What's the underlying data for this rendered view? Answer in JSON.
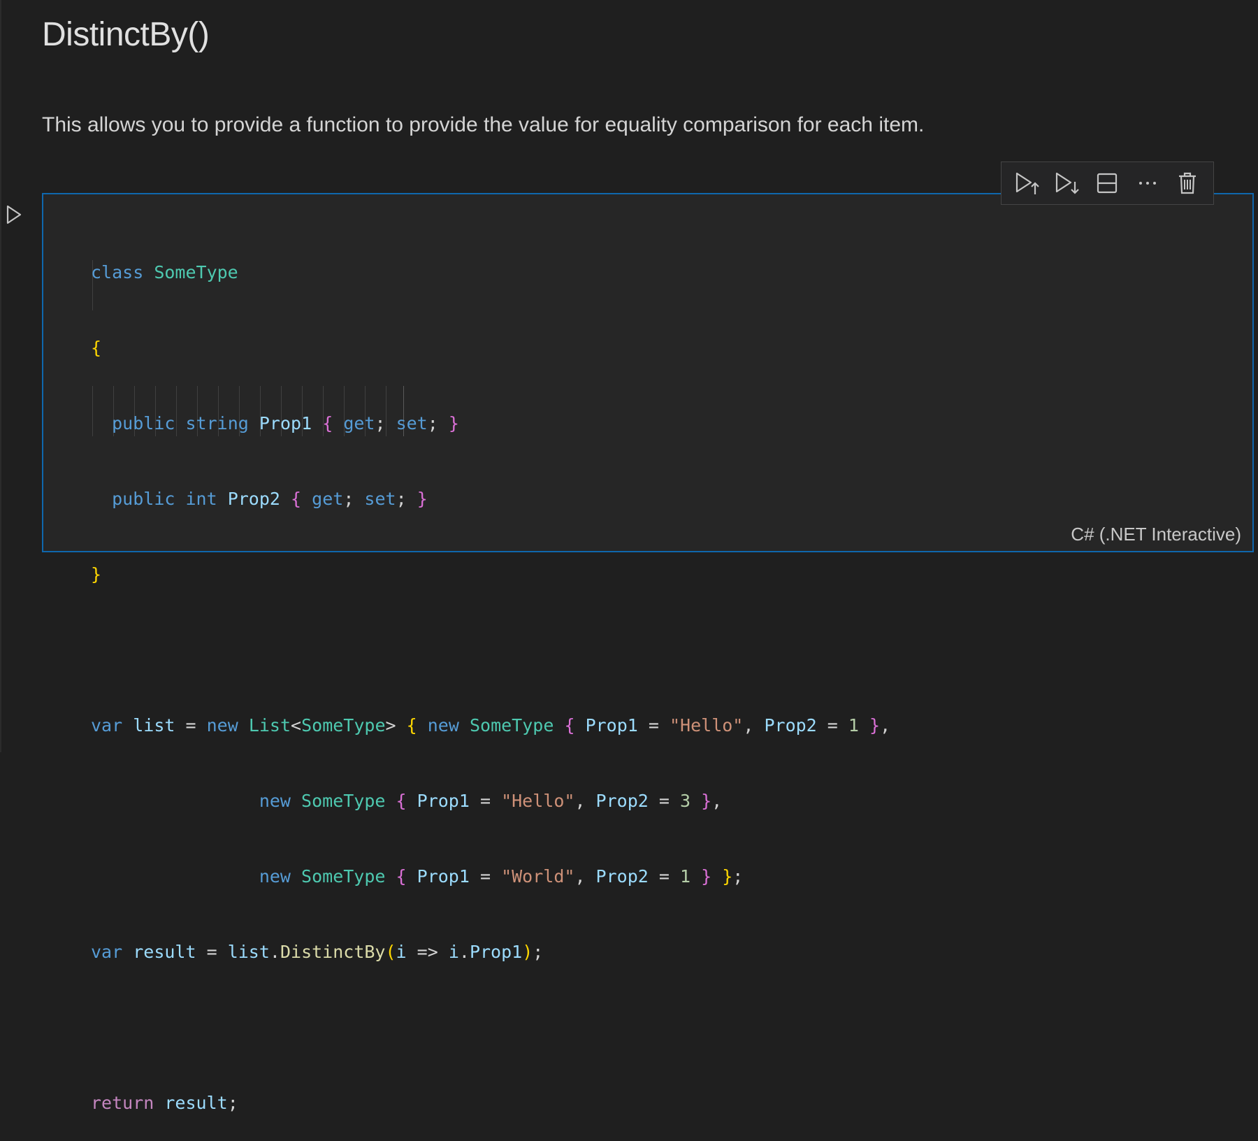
{
  "heading": "DistinctBy()",
  "description": "This allows you to provide a function to provide the value for equality comparison for each item.",
  "cell": {
    "language": "C# (.NET Interactive)",
    "code_lines": [
      "class SomeType",
      "{",
      "public string Prop1 { get; set; }",
      "public int Prop2 { get; set; }",
      "}",
      "",
      "var list = new List<SomeType> { new SomeType { Prop1 = \"Hello\", Prop2 = 1 },",
      "new SomeType { Prop1 = \"Hello\", Prop2 = 3 },",
      "new SomeType { Prop1 = \"World\", Prop2 = 1 } };",
      "var result = list.DistinctBy(i => i.Prop1);",
      "",
      "return result;"
    ]
  },
  "toolbar": {
    "buttons": [
      "execute-above-icon",
      "execute-below-icon",
      "split-cell-icon",
      "more-actions-icon",
      "delete-icon"
    ]
  },
  "colors": {
    "background": "#1f1f1f",
    "cell_border": "#0f67ad",
    "keyword": "#569cd6",
    "type": "#4ec9b0",
    "property": "#9cdcfe",
    "method": "#dcdcaa",
    "string": "#ce9178",
    "number": "#b5cea8",
    "control": "#c586c0",
    "bracket_1": "#ffd700",
    "bracket_2": "#da70d6"
  }
}
